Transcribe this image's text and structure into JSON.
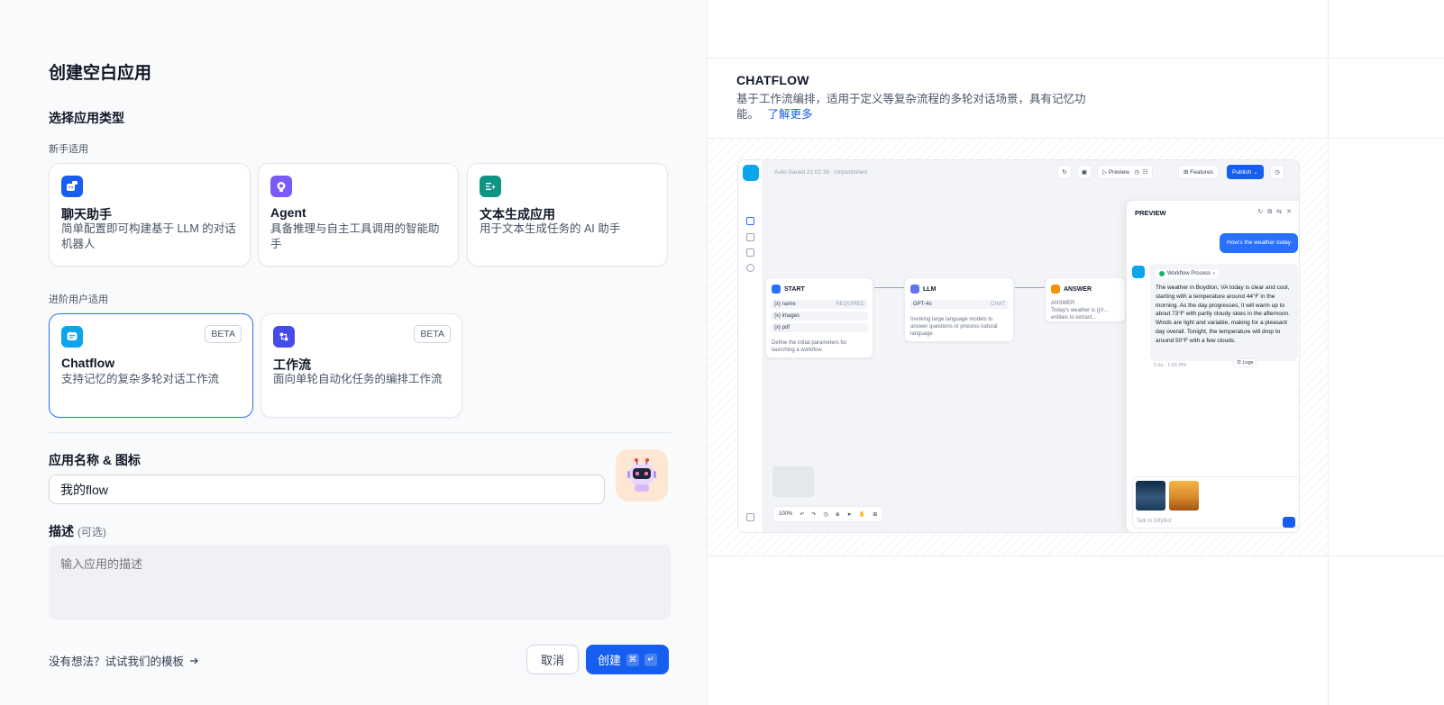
{
  "form": {
    "title": "创建空白应用",
    "type_section": "选择应用类型",
    "beginner_label": "新手适用",
    "advanced_label": "进阶用户适用",
    "cards": [
      {
        "title": "聊天助手",
        "desc": "简单配置即可构建基于 LLM 的对话机器人"
      },
      {
        "title": "Agent",
        "desc": "具备推理与自主工具调用的智能助手"
      },
      {
        "title": "文本生成应用",
        "desc": "用于文本生成任务的 AI 助手"
      },
      {
        "title": "Chatflow",
        "desc": "支持记忆的复杂多轮对话工作流",
        "badge": "BETA"
      },
      {
        "title": "工作流",
        "desc": "面向单轮自动化任务的编排工作流",
        "badge": "BETA"
      }
    ],
    "name_label": "应用名称 & 图标",
    "name_value": "我的flow",
    "desc_label": "描述",
    "desc_optional": "(可选)",
    "desc_placeholder": "输入应用的描述",
    "template_link": "没有想法？试试我们的模板",
    "cancel": "取消",
    "create": "创建",
    "create_kbd1": "⌘",
    "create_kbd2": "↵"
  },
  "preview_info": {
    "title": "CHATFLOW",
    "desc": "基于工作流编排，适用于定义等复杂流程的多轮对话场景，具有记忆功能。",
    "learn_more": "了解更多"
  },
  "screenshot": {
    "status": "Auto-Saved 21:02:35 · Unpublished",
    "toolbar": {
      "preview": "Preview",
      "features": "Features",
      "publish": "Publish"
    },
    "nodes": {
      "start": {
        "title": "START",
        "vars": [
          "name",
          "images",
          "pdf"
        ],
        "required": "REQUIRED",
        "desc": "Define the initial parameters for launching a workflow"
      },
      "llm": {
        "title": "LLM",
        "model": "GPT-4o",
        "mode": "CHAT",
        "desc": "Invoking large language models to answer questions or process natural language"
      },
      "answer": {
        "title": "ANSWER",
        "label": "ANSWER",
        "text": "Today's weather is {{#...",
        "sub": "entities to extract..."
      }
    },
    "chat": {
      "title": "PREVIEW",
      "user_msg": "How's the weather today",
      "workflow": "Workflow Process",
      "reply": "The weather in Boydton, VA today is clear and cool, starting with a temperature around 44°F in the morning. As the day progresses, it will warm up to about 73°F with partly cloudy skies in the afternoon. Winds are light and variable, making for a pleasant day overall. Tonight, the temperature will drop to around 50°F with a few clouds.",
      "meta": "5.6s · 1:55 PM",
      "logs": "Logs",
      "input_placeholder": "Talk to DifyBot"
    },
    "zoom": "100%",
    "badge_count": "2"
  }
}
